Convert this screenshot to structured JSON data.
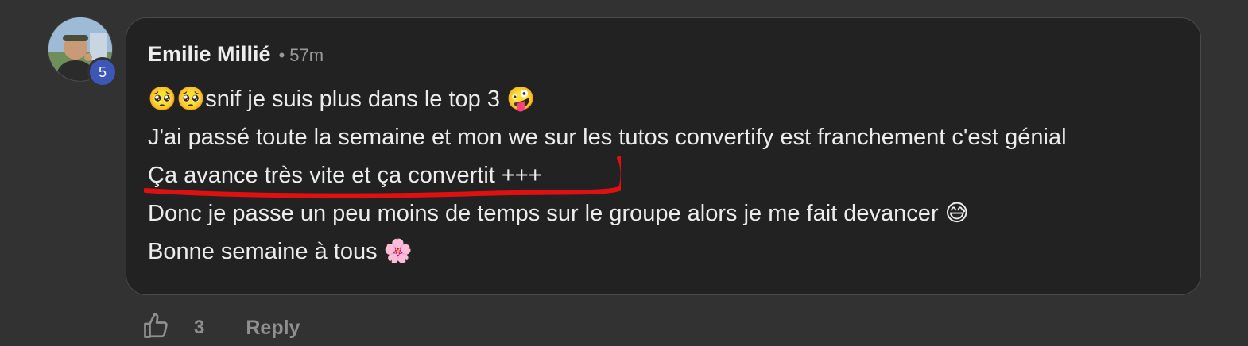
{
  "comment": {
    "author": "Emilie Millié",
    "separator": "•",
    "time": "57m",
    "level": "5",
    "lines": [
      "🥺🥺snif je suis plus dans le top 3 🤪",
      "J'ai passé toute la semaine et mon we sur les tutos convertify est franchement c'est génial",
      "Ça avance très vite et ça convertit +++",
      "Donc je passe un peu moins de temps sur le groupe alors je me fait devancer 😅",
      "Bonne semaine à tous 🌸"
    ],
    "like_count": "3",
    "reply_label": "Reply",
    "icons": {
      "like": "thumbs-up-icon",
      "avatar": "profile-photo"
    },
    "colors": {
      "background": "#323232",
      "bubble": "#222222",
      "badge": "#3d57b8",
      "highlight_stroke": "#e01010"
    }
  }
}
